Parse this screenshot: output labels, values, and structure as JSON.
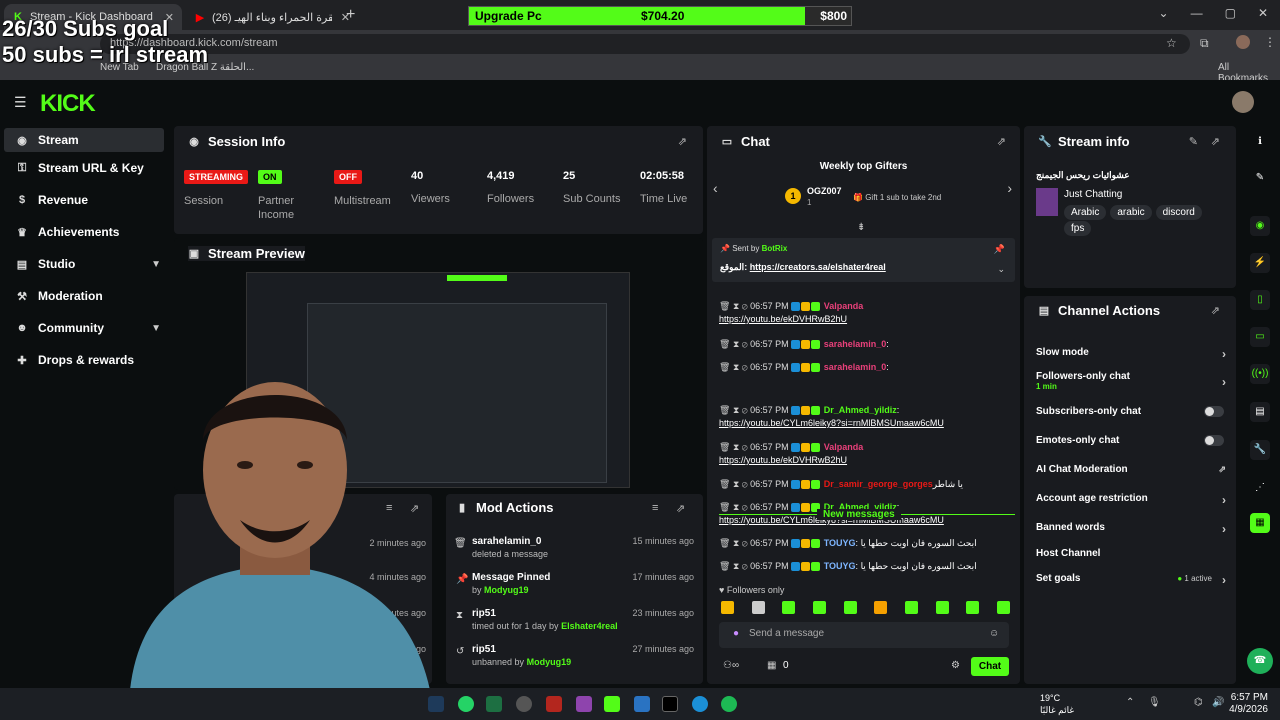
{
  "browser": {
    "tabs": [
      {
        "label": "Stream - Kick Dashboard"
      },
      {
        "label": "(26) قصة البقرة الحمراء وبناء الهيـ"
      }
    ],
    "url": "https://dashboard.kick.com/stream",
    "bookmarks": [
      "New Tab",
      "Dragon Ball Z الحلقة...",
      "All Bookmarks"
    ]
  },
  "overlay": {
    "goal_line1": "26/30 Subs goal",
    "goal_line2": "50 subs = irl stream",
    "donation_label": "Upgrade Pc",
    "donation_current": "$704.20",
    "donation_target": "$800",
    "donation_progress": 0.88
  },
  "sidebar": {
    "items": [
      {
        "label": "Stream",
        "icon": "broadcast-icon"
      },
      {
        "label": "Stream URL & Key",
        "icon": "key-icon"
      },
      {
        "label": "Revenue",
        "icon": "dollar-icon"
      },
      {
        "label": "Achievements",
        "icon": "trophy-icon"
      },
      {
        "label": "Studio",
        "icon": "layout-icon"
      },
      {
        "label": "Moderation",
        "icon": "hammer-icon"
      },
      {
        "label": "Community",
        "icon": "people-icon"
      },
      {
        "label": "Drops & rewards",
        "icon": "gift-icon"
      }
    ]
  },
  "session": {
    "title": "Session Info",
    "stats": [
      {
        "badge": "STREAMING",
        "label": "Session",
        "color": "#e91916"
      },
      {
        "badge": "ON",
        "label": "Partner Income",
        "color": "#53fc18"
      },
      {
        "badge": "OFF",
        "label": "Multistream",
        "color": "#e91916"
      },
      {
        "value": "40",
        "label": "Viewers"
      },
      {
        "value": "4,419",
        "label": "Followers"
      },
      {
        "value": "25",
        "label": "Sub Counts"
      },
      {
        "value": "02:05:58",
        "label": "Time Live"
      }
    ]
  },
  "preview": {
    "title": "Stream Preview"
  },
  "leaderboard": {
    "times": [
      "2 minutes ago",
      "4 minutes ago",
      "5 minutes ago",
      "6 minutes ago"
    ]
  },
  "mod_actions": {
    "title": "Mod Actions",
    "rows": [
      {
        "user": "sarahelamin_0",
        "desc": "deleted a message",
        "by": "",
        "time": "15 minutes ago",
        "icon": "trash-icon"
      },
      {
        "user": "Message Pinned",
        "desc": "by",
        "by": "Modyug19",
        "time": "17 minutes ago",
        "icon": "pin-icon"
      },
      {
        "user": "rip51",
        "desc": "timed out for 1 day by",
        "by": "Elshater4real",
        "time": "23 minutes ago",
        "icon": "hourglass-icon"
      },
      {
        "user": "rip51",
        "desc": "unbanned by",
        "by": "Modyug19",
        "time": "27 minutes ago",
        "icon": "undo-icon"
      }
    ]
  },
  "chat": {
    "title": "Chat",
    "top_gifters_title": "Weekly top Gifters",
    "top_gifter_name": "OGZ007",
    "top_gifter_count": "1",
    "top_gifter_hint": "Gift 1 sub to take 2nd",
    "pinned_sender_label": "Sent by",
    "pinned_sender": "BotRix",
    "pinned_prefix": "الموقع: ",
    "pinned_link": "https://creators.sa/elshater4real",
    "new_messages_label": "New messages",
    "followers_only": "Followers only",
    "input_placeholder": "Send a message",
    "points": "0",
    "send_label": "Chat",
    "messages": [
      {
        "time": "06:57 PM",
        "user": "Valpanda",
        "color": "#e8407a",
        "text": "",
        "link": "https://youtu.be/ekDVHRwB2hU"
      },
      {
        "time": "06:57 PM",
        "user": "sarahelamin_0",
        "color": "#e8407a",
        "text": ":",
        "link": ""
      },
      {
        "time": "06:57 PM",
        "user": "sarahelamin_0",
        "color": "#e8407a",
        "text": ":",
        "link": ""
      },
      {
        "time": "06:57 PM",
        "user": "Dr_Ahmed_yildiz",
        "color": "#53fc18",
        "text": ":",
        "link": "https://youtu.be/CYLm6leiky8?si=rnMlBMSUmaaw6cMU"
      },
      {
        "time": "06:57 PM",
        "user": "Valpanda",
        "color": "#e8407a",
        "text": "",
        "link": "https://youtu.be/ekDVHRwB2hU"
      },
      {
        "time": "06:57 PM",
        "user": "Dr_samir_george_gorges",
        "color": "#e91916",
        "text": "يا شاطر",
        "link": ""
      },
      {
        "time": "06:57 PM",
        "user": "Dr_Ahmed_yildiz",
        "color": "#53fc18",
        "text": ":",
        "link": "https://youtu.be/CYLm6leiky8?si=rnMlBMSUmaaw6cMU"
      },
      {
        "time": "06:57 PM",
        "user": "TOUYG",
        "color": "#7eb6ff",
        "text": ": ابحث السوره فان اوبت حطها يا",
        "link": ""
      },
      {
        "time": "06:57 PM",
        "user": "TOUYG",
        "color": "#7eb6ff",
        "text": ": ابحث السوره فان اوبت حطها يا",
        "link": ""
      }
    ]
  },
  "stream_info": {
    "title": "Stream info",
    "stream_title": "عشوائيات ريحس الجيمنج",
    "category": "Just Chatting",
    "tags": [
      "Arabic",
      "arabic",
      "discord",
      "fps"
    ]
  },
  "channel_actions": {
    "title": "Channel Actions",
    "rows": [
      {
        "label": "Slow mode",
        "kind": "chevron",
        "sub": ""
      },
      {
        "label": "Followers-only chat",
        "kind": "chevron",
        "sub": "1 min"
      },
      {
        "label": "Subscribers-only chat",
        "kind": "toggle",
        "sub": ""
      },
      {
        "label": "Emotes-only chat",
        "kind": "toggle",
        "sub": ""
      },
      {
        "label": "AI Chat Moderation",
        "kind": "external",
        "sub": ""
      },
      {
        "label": "Account age restriction",
        "kind": "chevron",
        "sub": ""
      },
      {
        "label": "Banned words",
        "kind": "chevron",
        "sub": ""
      },
      {
        "label": "Host Channel",
        "kind": "none",
        "sub": ""
      },
      {
        "label": "Set goals",
        "kind": "chevron",
        "sub": "1 active"
      }
    ]
  },
  "taskbar": {
    "weather_temp": "19°C",
    "weather_desc": "غائم غالبًا",
    "time": "6:57 PM",
    "date": "4/9/2026"
  },
  "colors": {
    "accent": "#53fc18",
    "panel": "#191b1f",
    "bg": "#0b0e0f",
    "live": "#e91916"
  }
}
